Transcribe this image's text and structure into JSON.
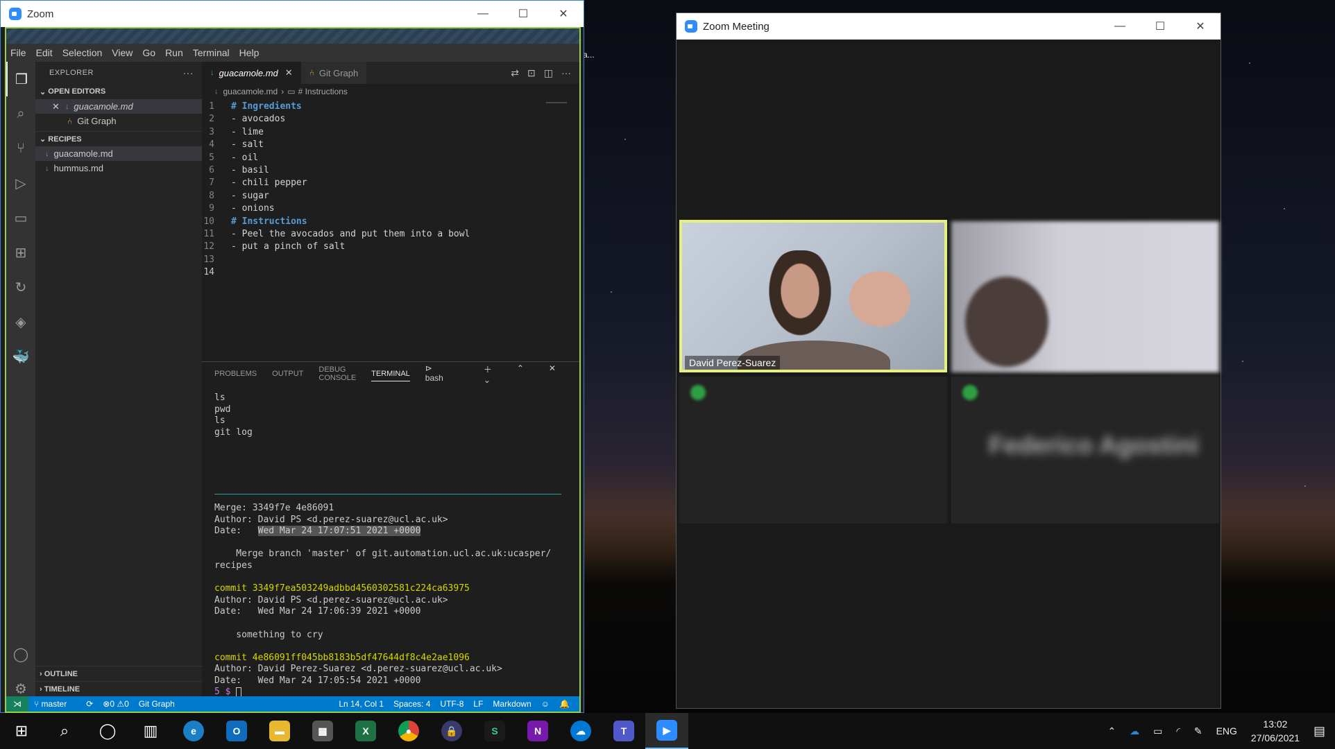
{
  "desktop": {
    "label": "a..."
  },
  "share_window": {
    "title": "Zoom"
  },
  "vscode": {
    "menu": [
      "File",
      "Edit",
      "Selection",
      "View",
      "Go",
      "Run",
      "Terminal",
      "Help"
    ],
    "explorer": {
      "title": "EXPLORER",
      "open_editors_label": "OPEN EDITORS",
      "open_editors": [
        "guacamole.md",
        "Git Graph"
      ],
      "recipes_label": "RECIPES",
      "recipes": [
        "guacamole.md",
        "hummus.md"
      ],
      "outline_label": "OUTLINE",
      "timeline_label": "TIMELINE"
    },
    "tabs": [
      {
        "label": "guacamole.md",
        "active": true
      },
      {
        "label": "Git Graph",
        "active": false
      }
    ],
    "breadcrumb": {
      "file": "guacamole.md",
      "section": "# Instructions"
    },
    "code_lines": [
      {
        "n": "1",
        "t": "# Ingredients",
        "h": true
      },
      {
        "n": "2",
        "t": "- avocados"
      },
      {
        "n": "3",
        "t": "- lime"
      },
      {
        "n": "4",
        "t": "- salt"
      },
      {
        "n": "5",
        "t": "- oil"
      },
      {
        "n": "6",
        "t": "- basil"
      },
      {
        "n": "7",
        "t": "- chili pepper"
      },
      {
        "n": "8",
        "t": "- sugar"
      },
      {
        "n": "9",
        "t": "- onions"
      },
      {
        "n": "10",
        "t": "# Instructions",
        "h": true
      },
      {
        "n": "11",
        "t": "- Peel the avocados and put them into a bowl"
      },
      {
        "n": "12",
        "t": "- put a pinch of salt"
      },
      {
        "n": "13",
        "t": ""
      },
      {
        "n": "14",
        "t": ""
      }
    ],
    "panel": {
      "tabs": [
        "PROBLEMS",
        "OUTPUT",
        "DEBUG CONSOLE",
        "TERMINAL"
      ],
      "shell": "bash"
    },
    "terminal": {
      "history": [
        "ls",
        "pwd",
        "ls",
        "git log"
      ],
      "merge_line": "Merge: 3349f7e 4e86091",
      "author1": "Author: David PS <d.perez-suarez@ucl.ac.uk>",
      "date1_prefix": "Date:   ",
      "date1": "Wed Mar 24 17:07:51 2021 +0000",
      "merge_msg1": "    Merge branch 'master' of git.automation.ucl.ac.uk:ucasper/",
      "merge_msg2": "recipes",
      "commit2": "commit 3349f7ea503249adbbd4560302581c224ca63975",
      "author2": "Author: David PS <d.perez-suarez@ucl.ac.uk>",
      "date2": "Date:   Wed Mar 24 17:06:39 2021 +0000",
      "msg2": "    something to cry",
      "commit3": "commit 4e86091ff045bb8183b5df47644df8c4e2ae1096",
      "author3": "Author: David Perez-Suarez <d.perez-suarez@ucl.ac.uk>",
      "date3": "Date:   Wed Mar 24 17:05:54 2021 +0000",
      "prompt": "5 $ "
    },
    "status": {
      "branch": "master",
      "problems": "⊗0 ⚠0",
      "git_graph": "Git Graph",
      "position": "Ln 14, Col 1",
      "spaces": "Spaces: 4",
      "encoding": "UTF-8",
      "eol": "LF",
      "language": "Markdown"
    }
  },
  "meeting": {
    "title": "Zoom Meeting",
    "participant_main": "David Perez-Suarez",
    "participant_blurred": "Federico Agostini"
  },
  "taskbar": {
    "lang": "ENG",
    "time": "13:02",
    "date": "27/06/2021"
  }
}
